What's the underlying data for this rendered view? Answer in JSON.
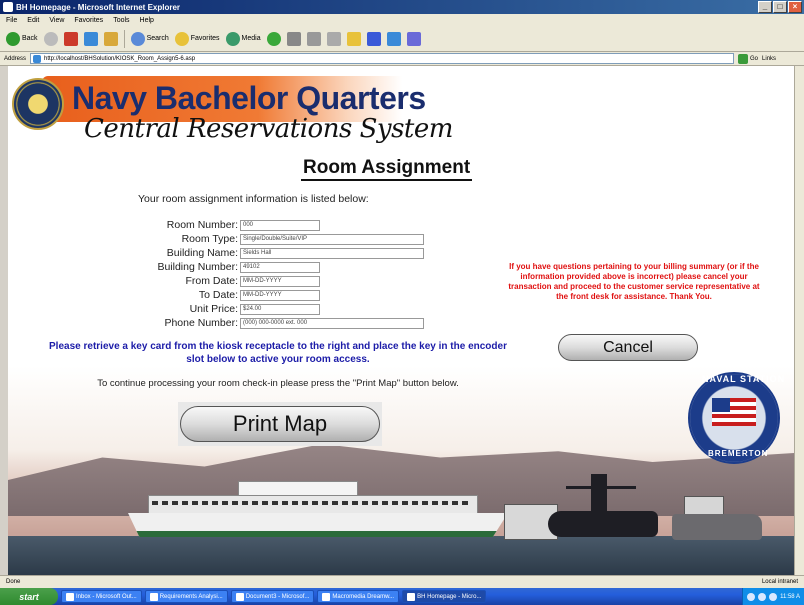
{
  "window": {
    "title": "BH Homepage - Microsoft Internet Explorer"
  },
  "menu": [
    "File",
    "Edit",
    "View",
    "Favorites",
    "Tools",
    "Help"
  ],
  "toolbar": {
    "back": "Back",
    "search": "Search",
    "favorites": "Favorites",
    "media": "Media"
  },
  "address": {
    "label": "Address",
    "url": "http://localhost/BHSolution/KIOSK_Room_Assign5-6.asp",
    "go": "Go",
    "links": "Links"
  },
  "banner": {
    "title": "Navy Bachelor Quarters",
    "subtitle": "Central Reservations System"
  },
  "page": {
    "title": "Room Assignment",
    "intro": "Your room assignment information is listed below:",
    "fields": [
      {
        "label": "Room Number:",
        "value": "000"
      },
      {
        "label": "Room Type:",
        "value": "Single/Double/Suite/VIP"
      },
      {
        "label": "Building Name:",
        "value": "Sields Hall"
      },
      {
        "label": "Building Number:",
        "value": "49102"
      },
      {
        "label": "From Date:",
        "value": "MM-DD-YYYY"
      },
      {
        "label": "To Date:",
        "value": "MM-DD-YYYY"
      },
      {
        "label": "Unit Price:",
        "value": "$24.00"
      },
      {
        "label": "Phone Number:",
        "value": "(000) 000-0000 ext. 000"
      }
    ],
    "billing_notice": "If you have questions pertaining to your billing summary (or if the information provided above is incorrect) please cancel your transaction and proceed to the customer service representative at the front desk for assistance. Thank You.",
    "key_instruction": "Please retrieve a key card from the kiosk receptacle to the right and place the key in the encoder slot below to active your room access.",
    "continue_text": "To continue processing your room check-in please press the \"Print Map\" button below.",
    "cancel_label": "Cancel",
    "print_label": "Print Map"
  },
  "seal": {
    "top": "NAVAL STATION",
    "bottom": "BREMERTON"
  },
  "status": {
    "left": "Done",
    "right": "Local intranet"
  },
  "taskbar": {
    "start": "start",
    "tasks": [
      "Inbox - Microsoft Out...",
      "Requirements Analysi...",
      "Document3 - Microsof...",
      "Macromedia Dreamw...",
      "BH Homepage - Micro..."
    ],
    "clock": "11:58 A"
  },
  "colors": {
    "accent_red": "#e01010",
    "accent_blue": "#1c1ca8",
    "banner_orange": "#e85f1c",
    "navy": "#1a2d6e"
  }
}
